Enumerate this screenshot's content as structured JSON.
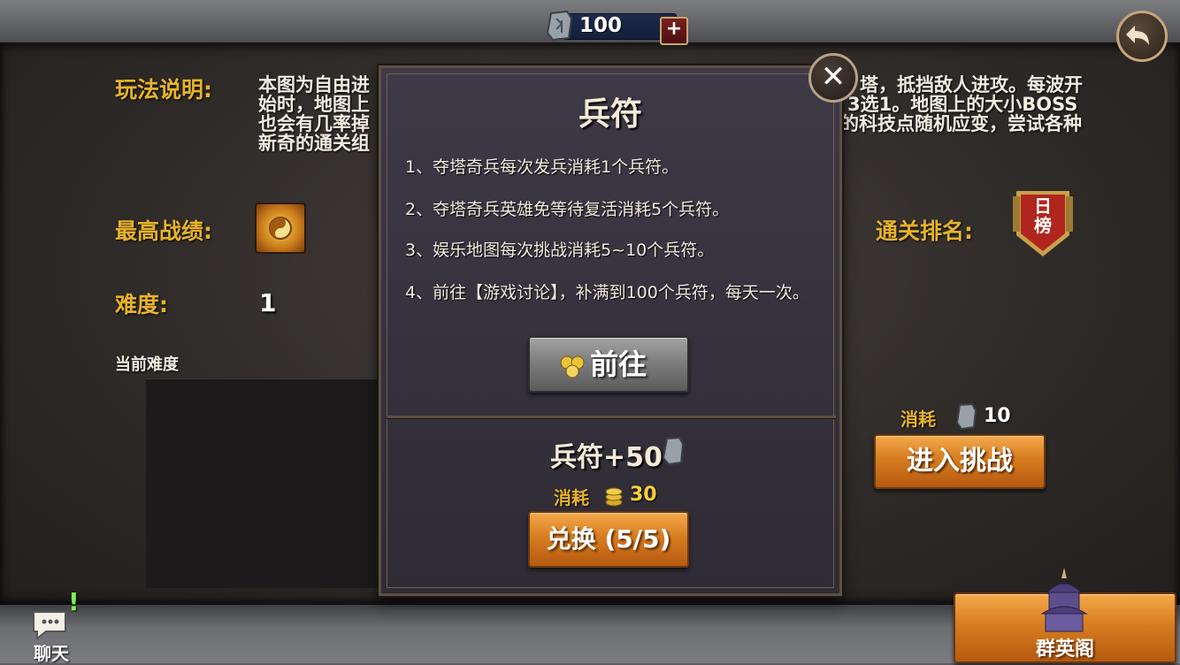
{
  "header": {
    "currency_value": "100",
    "plus_label": "+"
  },
  "info": {
    "rules_label": "玩法说明:",
    "rules_text_line1": "本图为自由进",
    "rules_text_line1b": "塔，抵挡敌人进攻。每波开",
    "rules_text_line2": "始时，地图上",
    "rules_text_line2b": "3选1。地图上的大小BOSS",
    "rules_text_line3": "也会有几率掉",
    "rules_text_line3b": "的科技点随机应变，尝试各种",
    "rules_text_line4": "新奇的通关组",
    "best_record_label": "最高战绩:",
    "difficulty_label": "难度:",
    "difficulty_value": "1",
    "current_difficulty_label": "当前难度",
    "rank_label": "通关排名:",
    "rank_badge_text_line1": "日",
    "rank_badge_text_line2": "榜"
  },
  "challenge": {
    "cost_label": "消耗",
    "cost_value": "10",
    "enter_button": "进入挑战"
  },
  "popup": {
    "title": "兵符",
    "rules": [
      "1、夺塔奇兵每次发兵消耗1个兵符。",
      "2、夺塔奇兵英雄免等待复活消耗5个兵符。",
      "3、娱乐地图每次挑战消耗5~10个兵符。",
      "4、前往【游戏讨论】，补满到100个兵符，每天一次。"
    ],
    "go_button": "前往",
    "close_label": "✕",
    "reward_text": "兵符+50",
    "exchange_cost_label": "消耗",
    "exchange_cost_value": "30",
    "exchange_button": "兑换 (5/5)"
  },
  "footer": {
    "chat_label": "聊天",
    "chat_alert": "!",
    "hall_label": "群英阁"
  },
  "colors": {
    "label_gold": "#e7b32a",
    "button_orange": "#d77d20",
    "popup_bg": "#3e3947"
  }
}
